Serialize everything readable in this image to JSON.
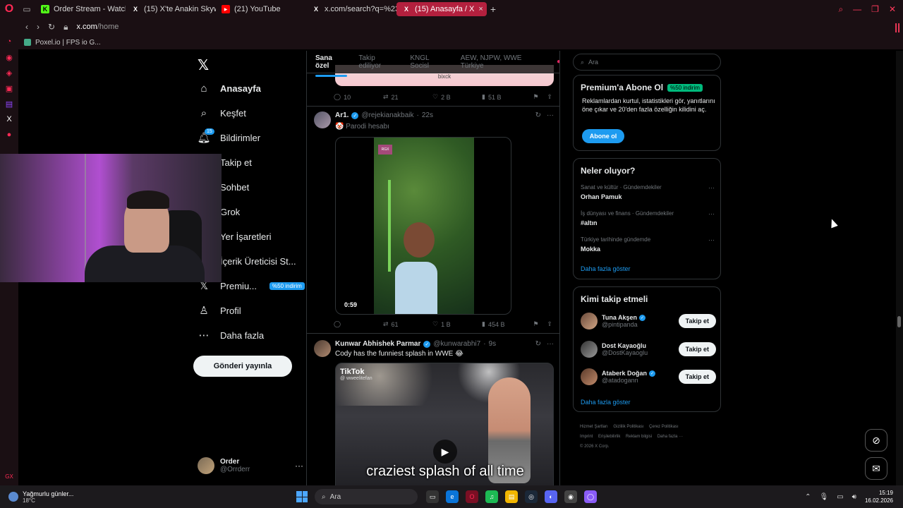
{
  "browser": {
    "tabs": [
      {
        "label": "Order Stream - Watch Live",
        "fav": "K",
        "fav_color": "#53fc18",
        "active": false
      },
      {
        "label": "(15) X'te Anakin Skywalker",
        "fav": "X",
        "fav_color": "#000000",
        "active": false
      },
      {
        "label": "(21) YouTube",
        "fav": "▶",
        "fav_color": "#ff0000",
        "active": false
      },
      {
        "label": "x.com/search?q=%23500",
        "fav": "X",
        "fav_color": "#000000",
        "active": false
      },
      {
        "label": "(15) Anasayfa / X",
        "fav": "X",
        "fav_color": "#000000",
        "active": true
      }
    ],
    "url_host": "x.com",
    "url_path": "/home",
    "bookmark": "Poxel.io | FPS io G..."
  },
  "nav": {
    "items": [
      {
        "label": "Anasayfa",
        "icon": "home-icon"
      },
      {
        "label": "Keşfet",
        "icon": "search-icon"
      },
      {
        "label": "Bildirimler",
        "icon": "bell-icon",
        "badge": "15"
      },
      {
        "label": "Takip et",
        "icon": "follow-icon"
      },
      {
        "label": "Sohbet",
        "icon": "chat-icon"
      },
      {
        "label": "Grok",
        "icon": "grok-icon"
      },
      {
        "label": "Yer İşaretleri",
        "icon": "bookmark-icon"
      },
      {
        "label": "İçerik Üreticisi St...",
        "icon": "creator-icon"
      },
      {
        "label": "Premiu...",
        "icon": "x-premium-icon",
        "discount": "%50 indirim"
      },
      {
        "label": "Profil",
        "icon": "profile-icon"
      },
      {
        "label": "Daha fazla",
        "icon": "more-icon"
      }
    ],
    "post_button": "Gönderi yayınla",
    "account": {
      "name": "Order",
      "handle": "@Orrderr"
    }
  },
  "feed": {
    "tabs": [
      "Sana özel",
      "Takip ediliyor",
      "KNGL Socisl",
      "AEW, NJPW, WWE Türkiye"
    ],
    "prev_media_text": "bixck",
    "prev_actions": {
      "replies": "10",
      "reposts": "21",
      "likes": "2 B",
      "views": "51 B"
    },
    "post1": {
      "name": "Ar1.",
      "handle": "@rejekianakbaik",
      "time": "22s",
      "text": "🤡 Parodi hesabı",
      "video_badge": "RGX",
      "duration": "0:59",
      "actions": {
        "replies": "",
        "reposts": "61",
        "likes": "1 B",
        "views": "454 B"
      }
    },
    "post2": {
      "name": "Kunwar Abhishek Parmar",
      "handle": "@kunwarabhi7",
      "time": "9s",
      "text": "Cody has the funniest splash in WWE 😂",
      "tiktok_label": "TikTok",
      "tiktok_handle": "@ wweelitefan",
      "caption": "craziest splash of all time"
    }
  },
  "right": {
    "search_placeholder": "Ara",
    "premium": {
      "title": "Premium'a Abone Ol",
      "discount": "%50 indirim",
      "desc": "Reklamlardan kurtul, istatistikleri gör, yanıtlarını öne çıkar ve 20'den fazla özelliğin kilidini aç.",
      "button": "Abone ol"
    },
    "trends": {
      "title": "Neler oluyor?",
      "items": [
        {
          "cat": "Sanat ve kültür · Gündemdekiler",
          "topic": "Orhan Pamuk"
        },
        {
          "cat": "İş dünyası ve finans · Gündemdekiler",
          "topic": "#altın"
        },
        {
          "cat": "Türkiye tarihinde gündemde",
          "topic": "Mokka"
        }
      ],
      "more": "Daha fazla göster"
    },
    "who": {
      "title": "Kimi takip etmeli",
      "items": [
        {
          "name": "Tuna Akşen",
          "handle": "@pintipanda",
          "button": "Takip et"
        },
        {
          "name": "Dost Kayaoğlu",
          "handle": "@DostKayaoglu",
          "button": "Takip et"
        },
        {
          "name": "Ataberk Doğan",
          "handle": "@atadogann",
          "button": "Takip et"
        }
      ],
      "more": "Daha fazla göster"
    },
    "footer": [
      "Hizmet Şartları",
      "Gizlilik Politikası",
      "Çerez Politikası",
      "Imprint",
      "Erişilebilirlik",
      "Reklam bilgisi",
      "Daha fazla ···",
      "© 2026 X Corp."
    ]
  },
  "taskbar": {
    "weather_title": "Yağmurlu günler...",
    "weather_temp": "18°C",
    "search_label": "Ara",
    "time": "15:19",
    "date": "16.02.2026"
  },
  "colors": {
    "accent": "#1d9bf0",
    "opera": "#ff2a55",
    "active_tab": "#b3203e"
  }
}
